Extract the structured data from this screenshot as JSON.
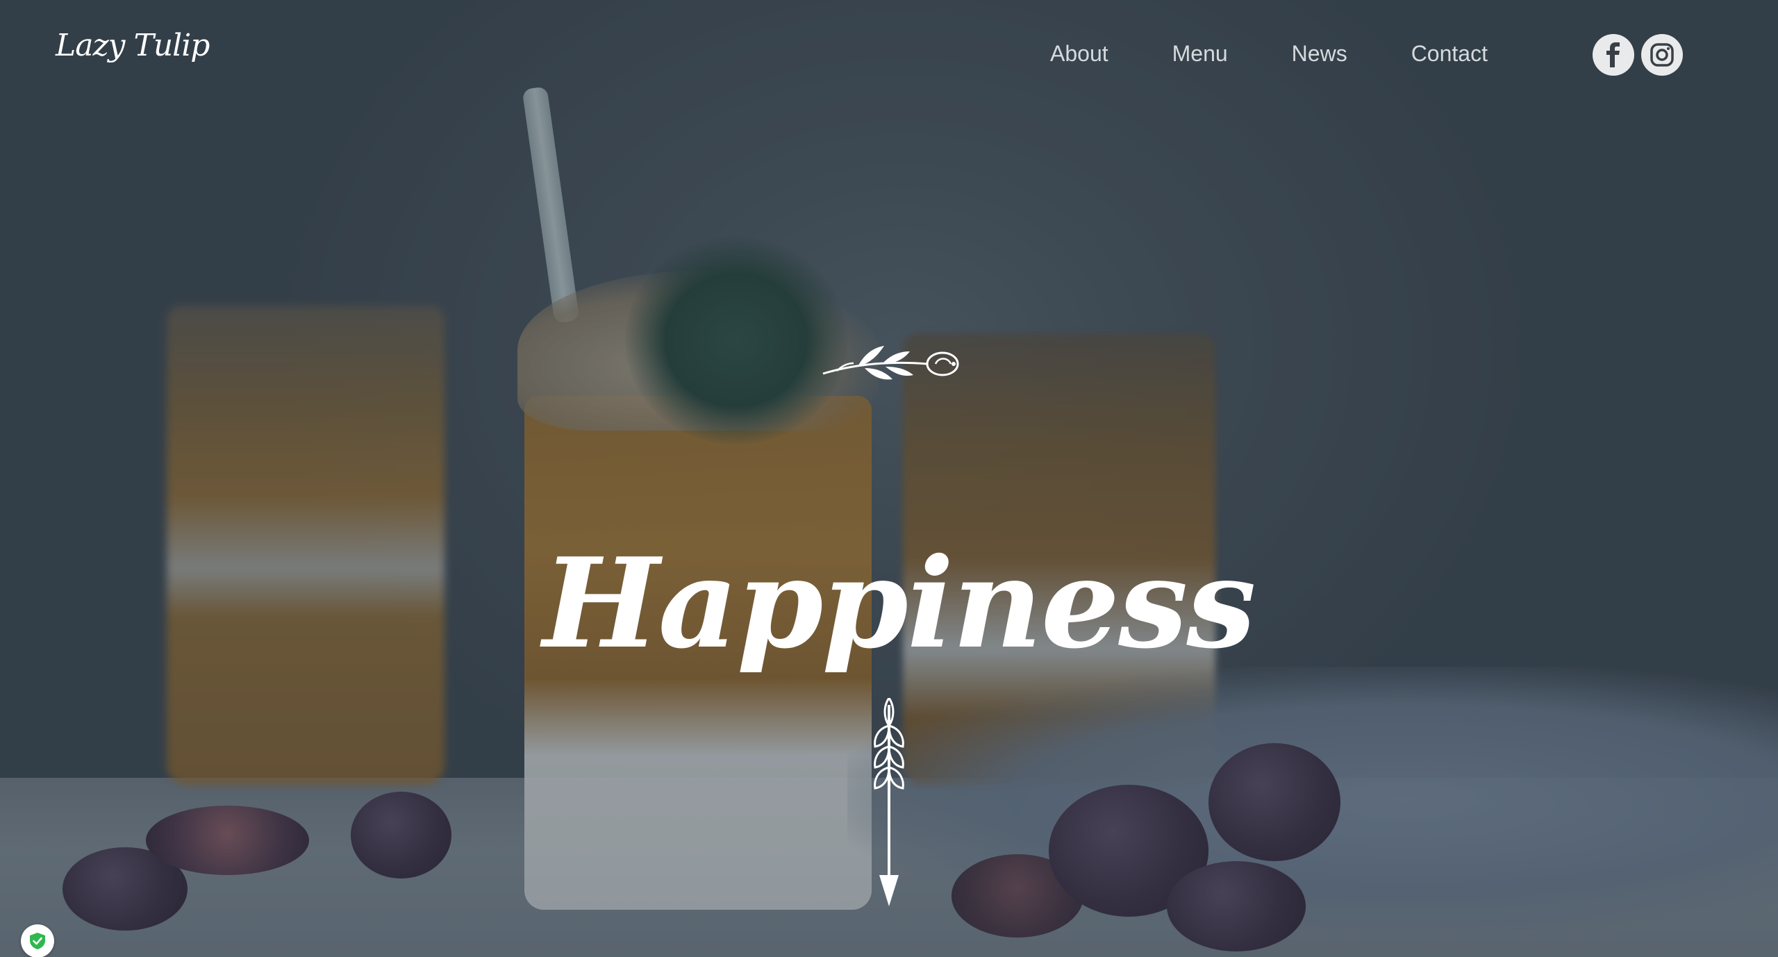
{
  "brand": {
    "logo_text": "Lazy Tulip"
  },
  "nav": {
    "items": [
      {
        "label": "About"
      },
      {
        "label": "Menu"
      },
      {
        "label": "News"
      },
      {
        "label": "Contact"
      }
    ]
  },
  "social": {
    "facebook_icon": "facebook-icon",
    "instagram_icon": "instagram-icon"
  },
  "hero": {
    "title": "Happiness",
    "ornament_icon": "flower-branch-icon",
    "scroll_icon": "arrow-down-wheat-icon"
  },
  "privacy_badge": {
    "icon": "shield-check-icon"
  },
  "colors": {
    "text": "#ffffff",
    "nav_text": "#d6dadd",
    "social_bg": "#e9eaeb",
    "social_icon": "#3a3f45",
    "badge_check": "#2fb84e"
  }
}
